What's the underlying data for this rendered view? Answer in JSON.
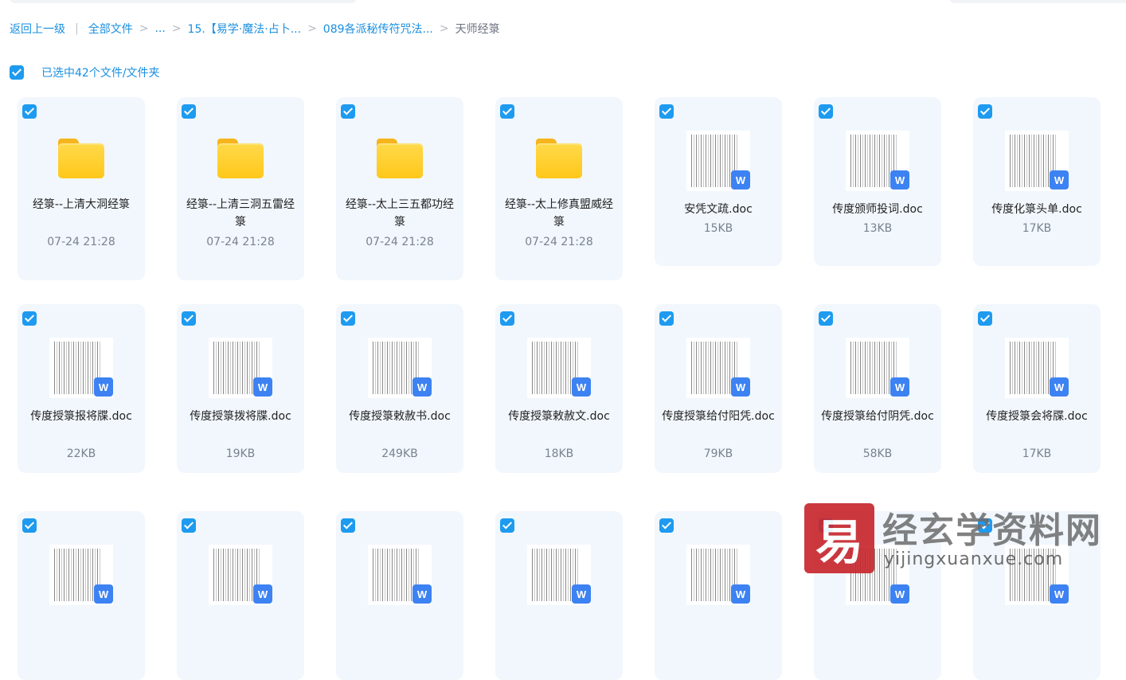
{
  "breadcrumb": {
    "back": "返回上一级",
    "separator": "|",
    "all_files": "全部文件",
    "ellipsis": "...",
    "crumb1": "15.【易学·魔法·占卜...",
    "crumb2": "089各派秘传符咒法...",
    "current": "天师经箓",
    "arrow": ">"
  },
  "selection": {
    "label": "已选中42个文件/文件夹"
  },
  "doc_badge": "W",
  "files": [
    {
      "name": "经箓--上清大洞经箓",
      "meta": "07-24 21:28",
      "type": "folder"
    },
    {
      "name": "经箓--上清三洞五雷经箓",
      "meta": "07-24 21:28",
      "type": "folder"
    },
    {
      "name": "经箓--太上三五都功经箓",
      "meta": "07-24 21:28",
      "type": "folder"
    },
    {
      "name": "经箓--太上修真盟威经箓",
      "meta": "07-24 21:28",
      "type": "folder"
    },
    {
      "name": "安凭文疏.doc",
      "meta": "15KB",
      "type": "doc"
    },
    {
      "name": "传度颁师投词.doc",
      "meta": "13KB",
      "type": "doc"
    },
    {
      "name": "传度化箓头单.doc",
      "meta": "17KB",
      "type": "doc"
    },
    {
      "name": "传度授箓报将牒.doc",
      "meta": "22KB",
      "type": "doc"
    },
    {
      "name": "传度授箓拨将牒.doc",
      "meta": "19KB",
      "type": "doc"
    },
    {
      "name": "传度授箓敕赦书.doc",
      "meta": "249KB",
      "type": "doc"
    },
    {
      "name": "传度授箓敕赦文.doc",
      "meta": "18KB",
      "type": "doc"
    },
    {
      "name": "传度授箓给付阳凭.doc",
      "meta": "79KB",
      "type": "doc"
    },
    {
      "name": "传度授箓给付阴凭.doc",
      "meta": "58KB",
      "type": "doc"
    },
    {
      "name": "传度授箓会将牒.doc",
      "meta": "17KB",
      "type": "doc"
    },
    {
      "name": "",
      "meta": "",
      "type": "doc"
    },
    {
      "name": "",
      "meta": "",
      "type": "doc"
    },
    {
      "name": "",
      "meta": "",
      "type": "doc"
    },
    {
      "name": "",
      "meta": "",
      "type": "doc"
    },
    {
      "name": "",
      "meta": "",
      "type": "doc"
    },
    {
      "name": "",
      "meta": "",
      "type": "doc"
    },
    {
      "name": "",
      "meta": "",
      "type": "doc"
    }
  ],
  "watermark": {
    "logo_char": "易",
    "title": "经玄学资料网",
    "url": "yijingxuanxue.com"
  },
  "colors": {
    "accent": "#1a8fe0",
    "checkbox": "#1e9bf0",
    "card_bg": "#f1f7fd",
    "doc_badge": "#3d82f2",
    "watermark_red": "#c7282e"
  }
}
